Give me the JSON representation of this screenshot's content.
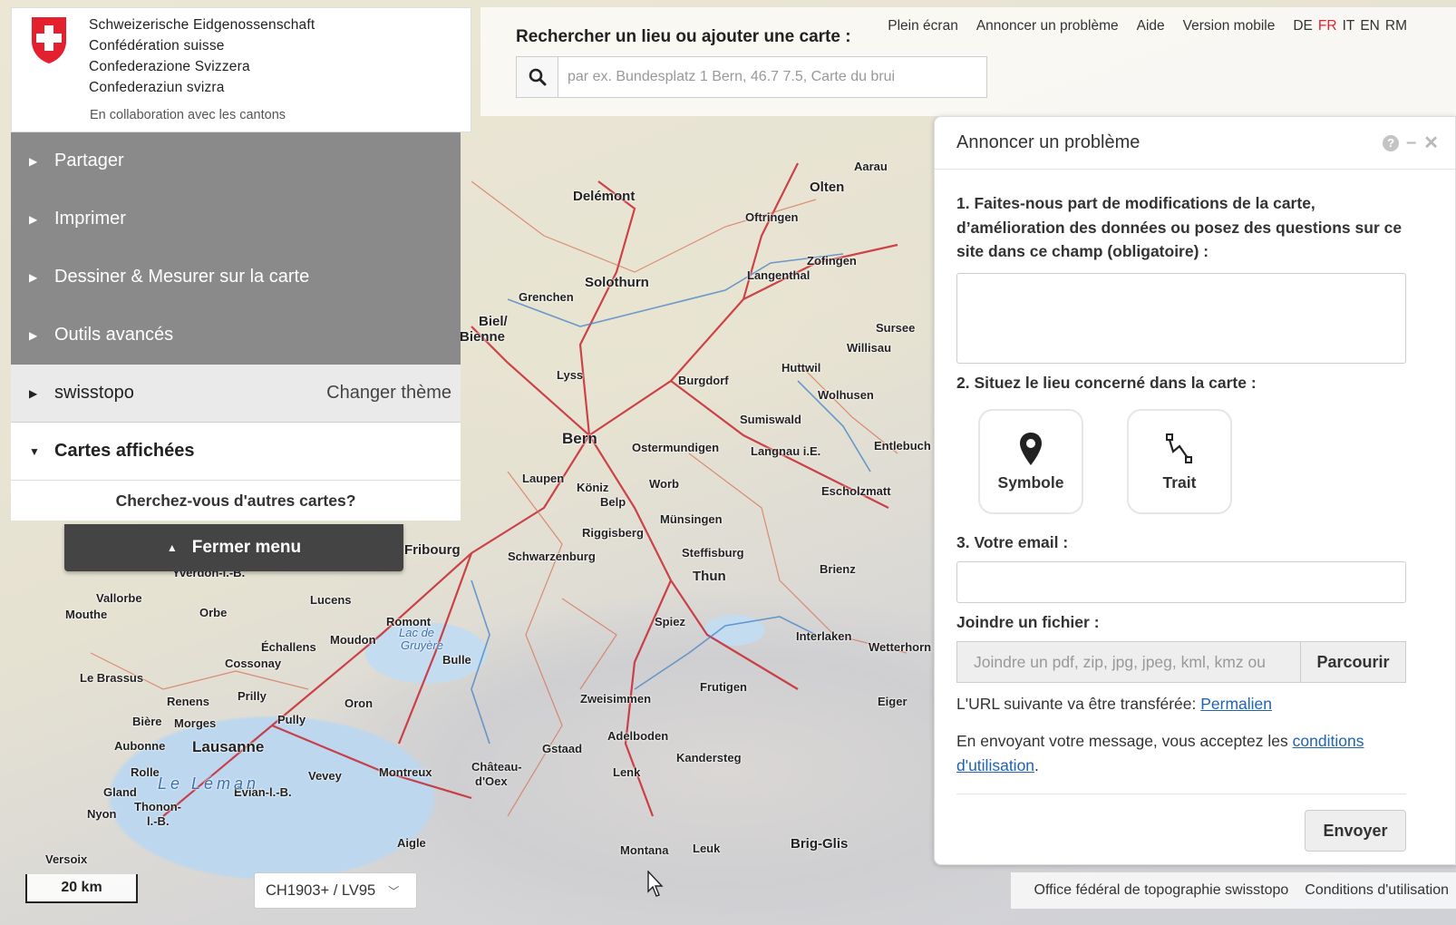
{
  "header": {
    "confederation_lines": [
      "Schweizerische Eidgenossenschaft",
      "Confédération suisse",
      "Confederazione Svizzera",
      "Confederaziun svizra"
    ],
    "collaboration": "En collaboration avec les cantons",
    "search_title": "Rechercher un lieu ou ajouter une carte :",
    "search_placeholder": "par ex. Bundesplatz 1 Bern, 46.7 7.5, Carte du brui",
    "links": {
      "fullscreen": "Plein écran",
      "report": "Annoncer un problème",
      "help": "Aide",
      "mobile": "Version mobile"
    },
    "languages": [
      "DE",
      "FR",
      "IT",
      "EN",
      "RM"
    ],
    "active_language": "FR"
  },
  "menu": {
    "items": [
      "Partager",
      "Imprimer",
      "Dessiner & Mesurer sur la carte",
      "Outils avancés"
    ],
    "theme": {
      "label": "swisstopo",
      "action": "Changer thème"
    },
    "displayed_maps": "Cartes affichées",
    "other_maps": "Cherchez-vous d'autres cartes?",
    "close": "Fermer menu"
  },
  "panel": {
    "title": "Annoncer un problème",
    "help_icon": "?",
    "minimize_icon": "–",
    "close_icon": "✕",
    "q1": "1. Faites-nous part de modifications de la carte, d’amélioration des données ou posez des questions sur ce site dans ce champ (obligatoire) :",
    "q2": "2. Situez le lieu concerné dans la carte :",
    "symbol_label": "Symbole",
    "line_label": "Trait",
    "q3": "3. Votre email :",
    "attach_label": "Joindre un fichier :",
    "attach_placeholder": "Joindre un pdf, zip, jpg, jpeg, kml, kmz ou",
    "browse": "Parcourir",
    "url_text": "L'URL suivante va être transférée:",
    "url_link": "Permalien",
    "terms_text": "En envoyant votre message, vous acceptez les",
    "terms_link1": "conditions",
    "terms_link2": "d'utilisation",
    "terms_end": ".",
    "send": "Envoyer"
  },
  "footer": {
    "scale": "20 km",
    "crs": "CH1903+ / LV95",
    "office": "Office fédéral de topographie swisstopo",
    "terms": "Conditions d'utilisation"
  },
  "map": {
    "towns": [
      "Delémont",
      "Solothurn",
      "Grenchen",
      "Biel/",
      "Bienne",
      "Olten",
      "Aarau",
      "Langenthal",
      "Zofingen",
      "Burgdorf",
      "Bern",
      "Ostermundigen",
      "Köniz",
      "Worb",
      "Münsingen",
      "Thun",
      "Steffisburg",
      "Spiez",
      "Interlaken",
      "Brienz",
      "Fribourg",
      "Bulle",
      "Lausanne",
      "Vevey",
      "Montreux",
      "Morges",
      "Renens",
      "Pully",
      "Prilly",
      "Yverdon-l.-B.",
      "Nyon",
      "Gland",
      "Rolle",
      "Thonon-",
      "l.-B.",
      "Gstaad",
      "Frutigen",
      "Lenk",
      "Adelboden",
      "Wetterhorn",
      "Eiger",
      "Lyss",
      "Laupen",
      "Oftringen",
      "Willisau",
      "Sursee",
      "Entlebuch",
      "Escholzmatt",
      "Wolhusen",
      "Huttwil",
      "Sumiswald",
      "Langnau i.E.",
      "Belp",
      "Riggisberg",
      "Schwarzenburg",
      "Zweisimmen",
      "Kandersteg",
      "Brig-Glis",
      "Leuk",
      "Montana",
      "Aigle",
      "Versoix",
      "Évian-l.-B.",
      "Château-",
      "d'Oex",
      "Romont",
      "Oron",
      "Moudon",
      "Échallens",
      "Lucens",
      "Orbe",
      "Vallorbe",
      "Mouthe",
      "Le Brassus",
      "Cossonay",
      "Aubonne",
      "Bière",
      "Lac de",
      "Gruyère",
      "Le Léman"
    ]
  }
}
